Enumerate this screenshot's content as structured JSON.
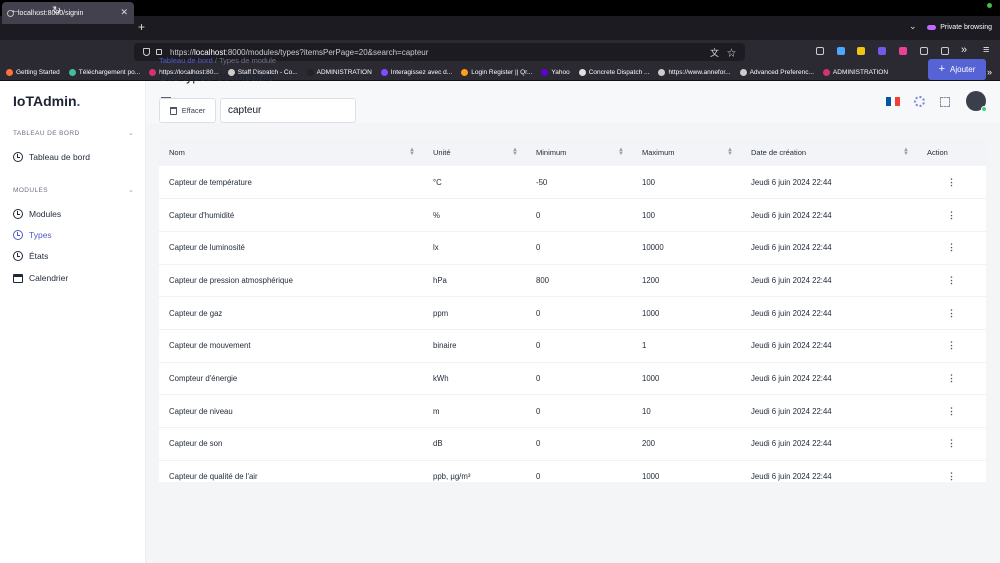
{
  "browser": {
    "tab_title": "localhost:8000/signin",
    "private_label": "Private browsing",
    "url_prefix": "https://",
    "url_host": "localhost",
    "url_rest": ":8000/modules/types?itemsPerPage=20&search=capteur",
    "bookmarks": [
      {
        "label": "Getting Started",
        "color": "#ff7139"
      },
      {
        "label": "Téléchargement po...",
        "color": "#3fbf9a"
      },
      {
        "label": "https://localhost:80...",
        "color": "#d6336c"
      },
      {
        "label": "Staff Dispatch - Co...",
        "color": "#cccccc"
      },
      {
        "label": "ADMINISTRATION",
        "color": "#222222"
      },
      {
        "label": "Interagissez avec d...",
        "color": "#7c4dff"
      },
      {
        "label": "Login Register || Qr...",
        "color": "#ff9f1c"
      },
      {
        "label": "Yahoo",
        "color": "#6001d2"
      },
      {
        "label": "Concrete Dispatch ...",
        "color": "#e0e0e0"
      },
      {
        "label": "https://www.annefor...",
        "color": "#cccccc"
      },
      {
        "label": "Advanced Preferenc...",
        "color": "#cccccc"
      },
      {
        "label": "ADMINISTRATION",
        "color": "#d6336c"
      }
    ]
  },
  "app": {
    "logo": "IoTAdmin",
    "logo_dot": ".",
    "accent": "#4e5bc8"
  },
  "sidebar": {
    "section_dashboard": "TABLEAU DE BORD",
    "dashboard_item": "Tableau de bord",
    "section_modules": "MODULES",
    "items": [
      {
        "label": "Modules",
        "active": false
      },
      {
        "label": "Types",
        "active": true
      },
      {
        "label": "États",
        "active": false
      },
      {
        "label": "Calendrier",
        "active": false
      }
    ]
  },
  "header": {
    "flag_colors": [
      "#0055a4",
      "#ffffff",
      "#ef4135"
    ]
  },
  "page": {
    "breadcrumb_root": "Tableau de bord",
    "breadcrumb_sep": "/",
    "breadcrumb_current": "Types de module",
    "title": "Les types de module",
    "add_button": "Ajouter",
    "clear_button": "Effacer",
    "search_value": "capteur"
  },
  "table": {
    "columns": [
      "Nom",
      "Unité",
      "Minimum",
      "Maximum",
      "Date de création",
      "Action"
    ],
    "rows": [
      [
        "Capteur de température",
        "°C",
        "-50",
        "100",
        "Jeudi 6 juin 2024 22:44"
      ],
      [
        "Capteur d'humidité",
        "%",
        "0",
        "100",
        "Jeudi 6 juin 2024 22:44"
      ],
      [
        "Capteur de luminosité",
        "lx",
        "0",
        "10000",
        "Jeudi 6 juin 2024 22:44"
      ],
      [
        "Capteur de pression atmosphérique",
        "hPa",
        "800",
        "1200",
        "Jeudi 6 juin 2024 22:44"
      ],
      [
        "Capteur de gaz",
        "ppm",
        "0",
        "1000",
        "Jeudi 6 juin 2024 22:44"
      ],
      [
        "Capteur de mouvement",
        "binaire",
        "0",
        "1",
        "Jeudi 6 juin 2024 22:44"
      ],
      [
        "Compteur d'énergie",
        "kWh",
        "0",
        "1000",
        "Jeudi 6 juin 2024 22:44"
      ],
      [
        "Capteur de niveau",
        "m",
        "0",
        "10",
        "Jeudi 6 juin 2024 22:44"
      ],
      [
        "Capteur de son",
        "dB",
        "0",
        "200",
        "Jeudi 6 juin 2024 22:44"
      ],
      [
        "Capteur de qualité de l'air",
        "ppb, µg/m³",
        "0",
        "1000",
        "Jeudi 6 juin 2024 22:44"
      ]
    ]
  }
}
